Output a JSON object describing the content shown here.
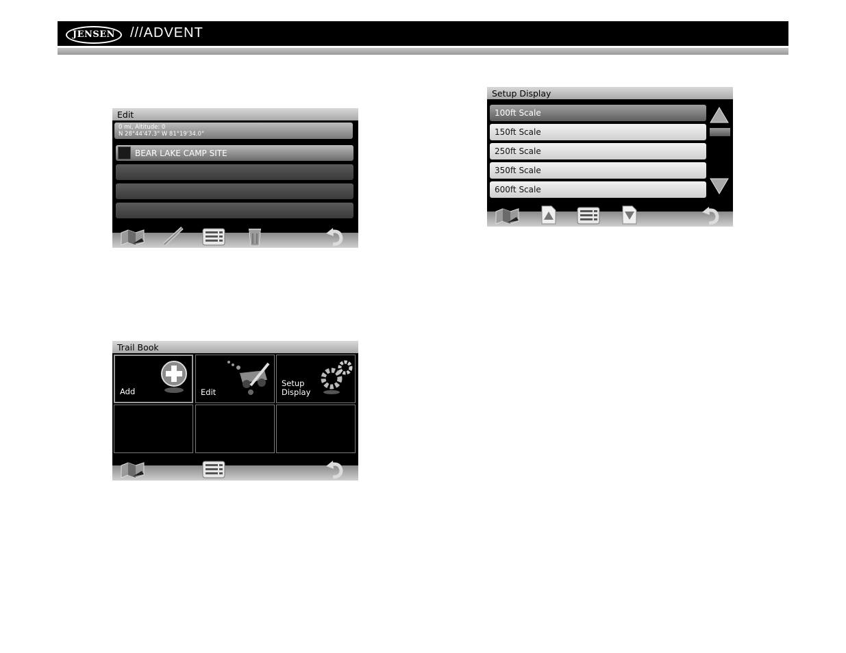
{
  "header": {
    "brand_left": "JENSEN",
    "brand_right": "///ADVENT"
  },
  "edit_screen": {
    "title": "Edit",
    "info_line1": "0 mi, Altitude: 0",
    "info_line2": "N 28°44'47.3\"  W 81°19'34.0\"",
    "items": [
      {
        "label": "BEAR LAKE CAMP SITE"
      },
      {
        "label": ""
      },
      {
        "label": ""
      },
      {
        "label": ""
      }
    ],
    "toolbar": [
      "map-icon",
      "pencil-icon",
      "list-icon",
      "trash-icon",
      "back-arrow-icon"
    ]
  },
  "setup_display_screen": {
    "title": "Setup Display",
    "options": [
      {
        "label": "100ft Scale"
      },
      {
        "label": "150ft Scale"
      },
      {
        "label": "250ft Scale"
      },
      {
        "label": "350ft Scale"
      },
      {
        "label": "600ft Scale"
      }
    ],
    "selected_index": 0,
    "toolbar": [
      "map-icon",
      "page-up-icon",
      "list-icon",
      "page-down-icon",
      "back-arrow-icon"
    ]
  },
  "trail_book_screen": {
    "title": "Trail Book",
    "cells": [
      {
        "label": "Add",
        "icon": "add-icon"
      },
      {
        "label": "Edit",
        "icon": "edit-vehicle-icon"
      },
      {
        "label": "Setup\nDisplay",
        "icon": "gears-icon"
      }
    ],
    "toolbar": [
      "map-icon",
      "list-icon",
      "back-arrow-icon"
    ]
  },
  "colors": {
    "screen_bg": "#000000",
    "title_bar": "#c0c0c0",
    "header_bg": "#000000"
  }
}
